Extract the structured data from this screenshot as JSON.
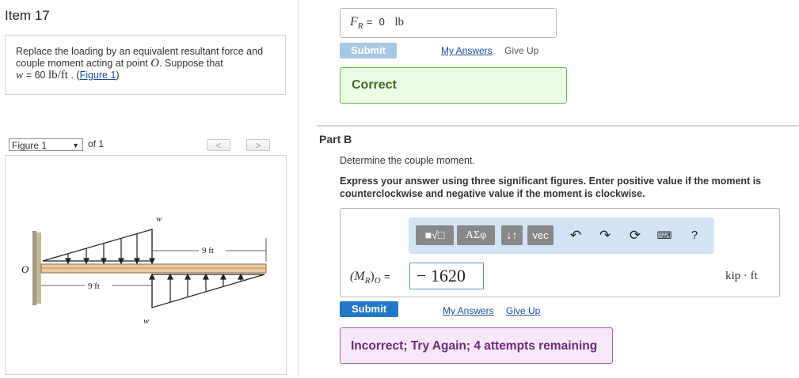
{
  "item": {
    "title": "Item 17"
  },
  "problem": {
    "text_before": "Replace the loading by an equivalent resultant force and couple moment acting at point ",
    "point_label": "O",
    "text_after": ". Suppose that",
    "w_label": "w",
    "w_equals": " = 60 ",
    "w_unit": "lb/ft",
    "figure_link": "Figure 1"
  },
  "figure_nav": {
    "selected": "Figure 1",
    "of_text": "of 1",
    "prev_icon": "chevron-left-icon",
    "next_icon": "chevron-right-icon"
  },
  "figure": {
    "point_label": "O",
    "w_top": "w",
    "w_bottom": "w",
    "dim_top": "9 ft",
    "dim_bottom": "9 ft"
  },
  "part_a": {
    "answer_label": "F",
    "answer_subscript": "R",
    "answer_equals": "=",
    "answer_value": "0",
    "answer_unit": "lb",
    "submit_label": "Submit",
    "my_answers_label": "My Answers",
    "give_up_label": "Give Up",
    "feedback": "Correct"
  },
  "part_b": {
    "title": "Part B",
    "prompt": "Determine the couple moment.",
    "instructions": "Express your answer using three significant figures. Enter positive value if the moment is counterclockwise and negative value if the moment is clockwise.",
    "toolbar": {
      "template_label": "■√□",
      "greek_label": "ΑΣφ",
      "arrows_label": "↓↑",
      "vec_label": "vec",
      "undo_icon": "undo-icon",
      "redo_icon": "redo-icon",
      "reset_icon": "reset-icon",
      "keyboard_icon": "keyboard-icon",
      "help_label": "?"
    },
    "answer_label": "(M",
    "answer_subscript": "R",
    "answer_close": ")",
    "answer_point": "O",
    "answer_equals": "=",
    "answer_value": "− 1620",
    "answer_unit": "kip · ft",
    "submit_label": "Submit",
    "my_answers_label": "My Answers",
    "give_up_label": "Give Up",
    "feedback": "Incorrect; Try Again; 4 attempts remaining"
  },
  "colors": {
    "correct_bg": "#ecfbe6",
    "correct_border": "#5fbf3b",
    "incorrect_bg": "#f6e8f9",
    "incorrect_border": "#a95ab8",
    "submit_active": "#2277c8",
    "submit_disabled": "#a9c7e3",
    "link": "#1a4e9b"
  }
}
